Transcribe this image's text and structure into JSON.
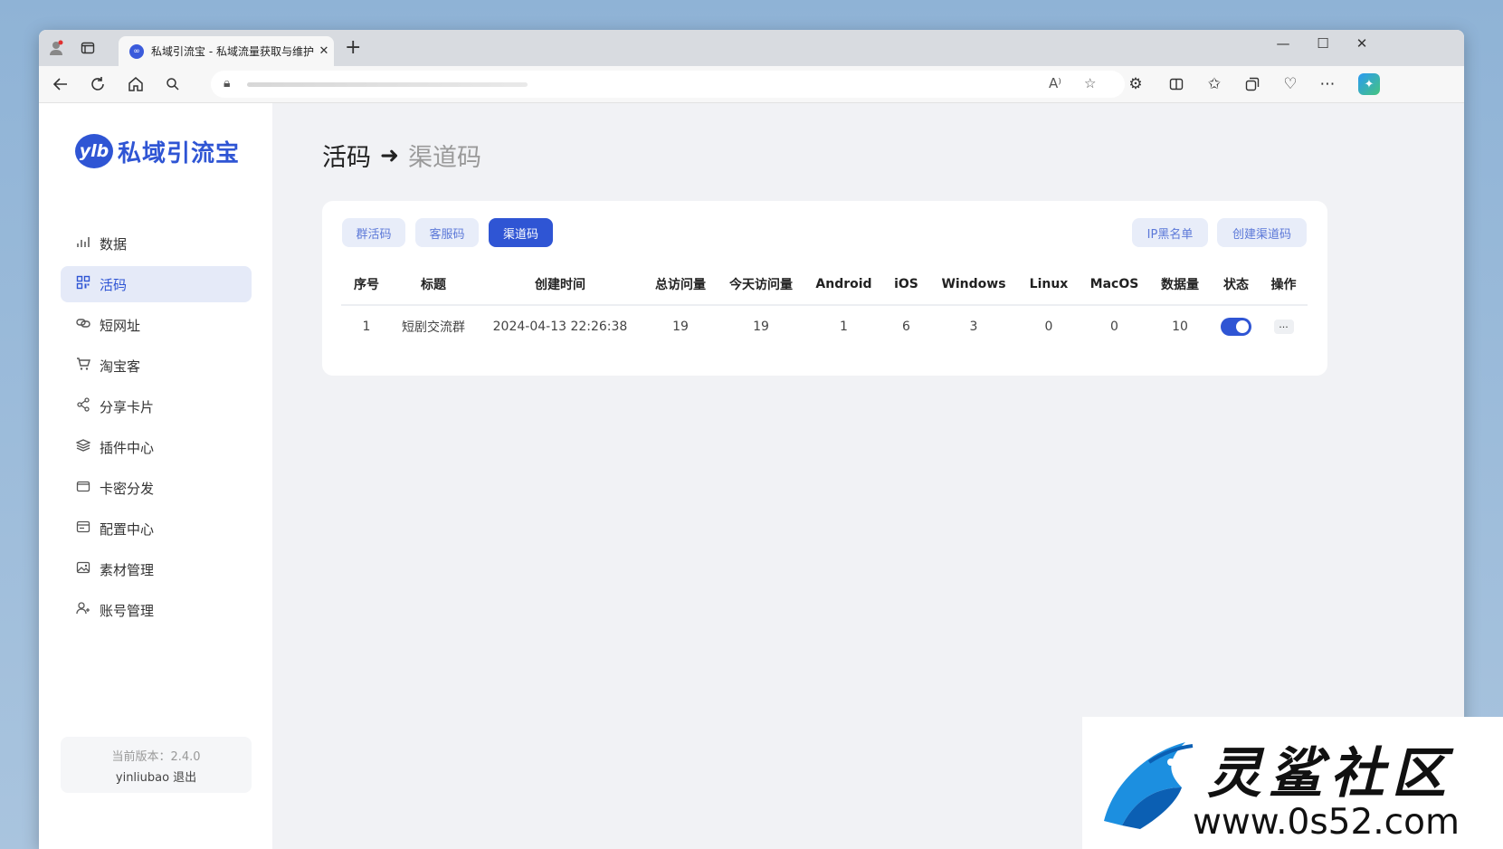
{
  "browser": {
    "tab_title": "私域引流宝 - 私域流量获取与维护",
    "tab_favicon": "infinity-logo-icon",
    "address_icons": [
      "read-aloud-icon",
      "favorite-star-icon"
    ],
    "toolbar_icons": [
      "extensions-icon",
      "split-screen-icon",
      "favorites-icon",
      "collections-icon",
      "browser-essentials-icon",
      "more-icon",
      "copilot-icon"
    ]
  },
  "app": {
    "logo_badge": "ylb",
    "logo_text": "私域引流宝",
    "accent_color": "#2f55d4"
  },
  "sidebar": {
    "items": [
      {
        "label": "数据",
        "icon": "bar-chart-icon"
      },
      {
        "label": "活码",
        "icon": "grid-qrcode-icon",
        "active": true
      },
      {
        "label": "短网址",
        "icon": "link-icon"
      },
      {
        "label": "淘宝客",
        "icon": "shopping-cart-icon"
      },
      {
        "label": "分享卡片",
        "icon": "share-icon"
      },
      {
        "label": "插件中心",
        "icon": "layers-icon"
      },
      {
        "label": "卡密分发",
        "icon": "card-icon"
      },
      {
        "label": "配置中心",
        "icon": "settings-panel-icon"
      },
      {
        "label": "素材管理",
        "icon": "image-icon"
      },
      {
        "label": "账号管理",
        "icon": "user-add-icon"
      }
    ],
    "version": "当前版本：2.4.0",
    "username": "yinliubao",
    "logout": "退出"
  },
  "breadcrumb": {
    "parent": "活码",
    "current": "渠道码"
  },
  "tabs": {
    "group": "群活码",
    "service": "客服码",
    "channel": "渠道码"
  },
  "actions": {
    "ip_blacklist": "IP黑名单",
    "create": "创建渠道码"
  },
  "table": {
    "headers": [
      "序号",
      "标题",
      "创建时间",
      "总访问量",
      "今天访问量",
      "Android",
      "iOS",
      "Windows",
      "Linux",
      "MacOS",
      "数据量",
      "状态",
      "操作"
    ],
    "rows": [
      {
        "index": "1",
        "title": "短剧交流群",
        "created": "2024-04-13 22:26:38",
        "total_visits": "19",
        "today_visits": "19",
        "android": "1",
        "ios": "6",
        "windows": "3",
        "linux": "0",
        "macos": "0",
        "data_count": "10",
        "status_enabled": true,
        "more": "..."
      }
    ]
  },
  "watermark": {
    "title": "灵鲨社区",
    "url": "www.0s52.com"
  }
}
